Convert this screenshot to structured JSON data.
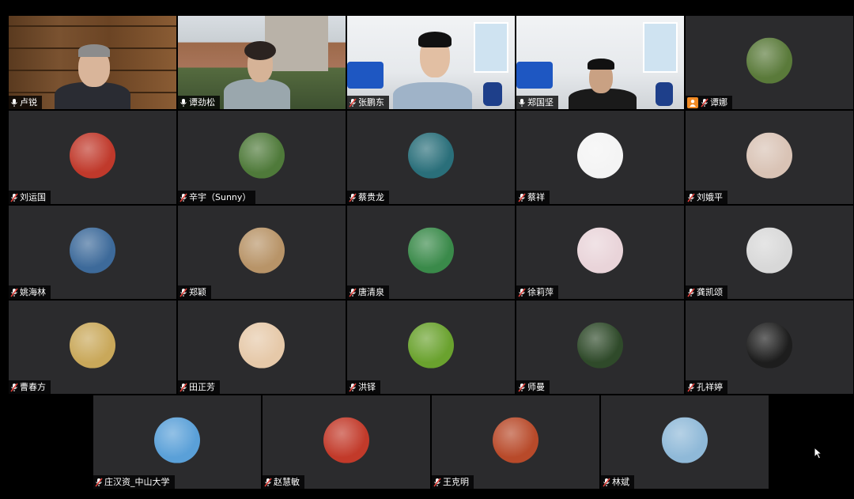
{
  "participants": [
    {
      "name": "卢锐",
      "mic": "on",
      "kind": "video",
      "scene": "library",
      "color": "#6b4a2a"
    },
    {
      "name": "谭劲松",
      "mic": "on",
      "kind": "video",
      "scene": "campus",
      "color": "#7c8a6a"
    },
    {
      "name": "张鹏东",
      "mic": "muted",
      "kind": "video",
      "scene": "office",
      "color": "#dfe4ea"
    },
    {
      "name": "郑国坚",
      "mic": "on",
      "kind": "video",
      "scene": "office2",
      "color": "#dfe4ea"
    },
    {
      "name": "谭娜",
      "mic": "muted",
      "kind": "avatar",
      "host": true,
      "avatar_icon": "garden-avatar-icon",
      "avatar_color": "#5a7a3a"
    },
    {
      "name": "刘运国",
      "mic": "muted",
      "kind": "avatar",
      "avatar_icon": "gate-avatar-icon",
      "avatar_color": "#c0392b"
    },
    {
      "name": "辛宇（Sunny）",
      "mic": "muted",
      "kind": "avatar",
      "avatar_icon": "building-avatar-icon",
      "avatar_color": "#4f7a3a"
    },
    {
      "name": "蔡贵龙",
      "mic": "muted",
      "kind": "avatar",
      "avatar_icon": "underwater-avatar-icon",
      "avatar_color": "#2a6f7a"
    },
    {
      "name": "蔡祥",
      "mic": "muted",
      "kind": "avatar",
      "avatar_icon": "cabbage-avatar-icon",
      "avatar_color": "#f4f4f4"
    },
    {
      "name": "刘娥平",
      "mic": "muted",
      "kind": "avatar",
      "avatar_icon": "portrait-avatar-icon",
      "avatar_color": "#d9c3b5"
    },
    {
      "name": "姚海林",
      "mic": "muted",
      "kind": "avatar",
      "avatar_icon": "badge-avatar-icon",
      "avatar_color": "#3d6a9a"
    },
    {
      "name": "郑颖",
      "mic": "muted",
      "kind": "avatar",
      "avatar_icon": "tea-avatar-icon",
      "avatar_color": "#b89468"
    },
    {
      "name": "唐清泉",
      "mic": "muted",
      "kind": "avatar",
      "avatar_icon": "lotus-avatar-icon",
      "avatar_color": "#3a8a4a"
    },
    {
      "name": "徐莉萍",
      "mic": "muted",
      "kind": "avatar",
      "avatar_icon": "art-avatar-icon",
      "avatar_color": "#e9d4d9"
    },
    {
      "name": "龚凯颂",
      "mic": "muted",
      "kind": "avatar",
      "avatar_icon": "person-avatar-icon",
      "avatar_color": "#d8d8d8"
    },
    {
      "name": "曹春方",
      "mic": "muted",
      "kind": "avatar",
      "avatar_icon": "boat-avatar-icon",
      "avatar_color": "#c9a85a"
    },
    {
      "name": "田正芳",
      "mic": "muted",
      "kind": "avatar",
      "avatar_icon": "cartoon-avatar-icon",
      "avatar_color": "#e6c9a9"
    },
    {
      "name": "洪铎",
      "mic": "muted",
      "kind": "avatar",
      "avatar_icon": "hill-avatar-icon",
      "avatar_color": "#6aa22e"
    },
    {
      "name": "师曼",
      "mic": "muted",
      "kind": "avatar",
      "avatar_icon": "dandelion-avatar-icon",
      "avatar_color": "#2f4a2a"
    },
    {
      "name": "孔祥婷",
      "mic": "muted",
      "kind": "avatar",
      "avatar_icon": "person2-avatar-icon",
      "avatar_color": "#1d1d1d"
    }
  ],
  "bottom_row": [
    {
      "name": "庄汉资_中山大学",
      "mic": "muted",
      "kind": "avatar",
      "avatar_icon": "car-avatar-icon",
      "avatar_color": "#5aa0d8"
    },
    {
      "name": "赵慧敏",
      "mic": "muted",
      "kind": "avatar",
      "avatar_icon": "bonsai-avatar-icon",
      "avatar_color": "#c23a2a"
    },
    {
      "name": "王克明",
      "mic": "muted",
      "kind": "avatar",
      "avatar_icon": "autumn-avatar-icon",
      "avatar_color": "#b84a2a"
    },
    {
      "name": "林斌",
      "mic": "muted",
      "kind": "avatar",
      "avatar_icon": "beach-avatar-icon",
      "avatar_color": "#8fb9d8"
    }
  ]
}
